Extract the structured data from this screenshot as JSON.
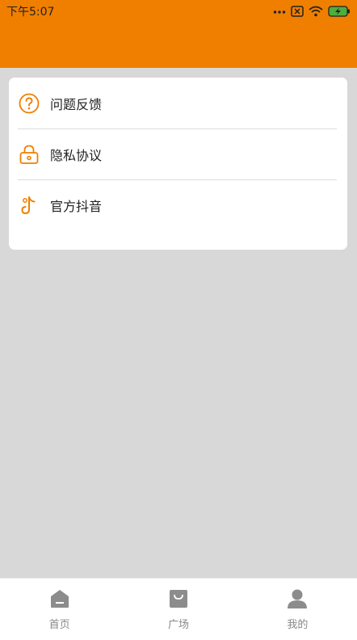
{
  "status_bar": {
    "time": "下午5:07",
    "icons": [
      "dots-icon",
      "close-box-icon",
      "wifi-icon",
      "battery-charging-icon"
    ]
  },
  "colors": {
    "accent": "#f07f00",
    "page_bg": "#d8d8d8",
    "icon_orange": "#f07f00",
    "nav_gray": "#888888"
  },
  "menu": {
    "items": [
      {
        "label": "问题反馈",
        "icon": "question-icon"
      },
      {
        "label": "隐私协议",
        "icon": "lock-icon"
      },
      {
        "label": "官方抖音",
        "icon": "douyin-icon"
      }
    ]
  },
  "bottom_nav": {
    "items": [
      {
        "label": "首页",
        "icon": "home-icon"
      },
      {
        "label": "广场",
        "icon": "shopping-bag-icon"
      },
      {
        "label": "我的",
        "icon": "user-icon"
      }
    ]
  }
}
